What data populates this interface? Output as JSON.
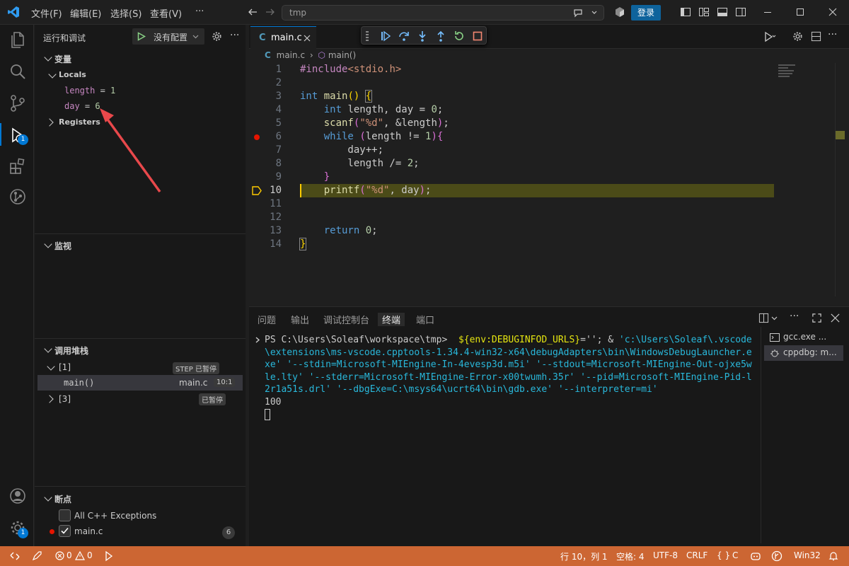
{
  "titlebar": {
    "menus": [
      "文件(F)",
      "编辑(E)",
      "选择(S)",
      "查看(V)",
      "···"
    ],
    "command_center": "tmp",
    "login_label": "登录"
  },
  "activity": {
    "debug_badge": "1",
    "settings_badge": "1"
  },
  "sidebar": {
    "title": "运行和调试",
    "config_label": "没有配置",
    "variables_title": "变量",
    "locals_label": "Locals",
    "locals": [
      {
        "name": "length",
        "value": "1"
      },
      {
        "name": "day",
        "value": "6"
      }
    ],
    "registers_label": "Registers",
    "watch_title": "监视",
    "callstack_title": "调用堆栈",
    "threads": [
      {
        "label": "[1]",
        "status": "STEP 已暂停"
      },
      {
        "label": "[3]",
        "status": "已暂停"
      }
    ],
    "frame": {
      "name": "main()",
      "file": "main.c",
      "pos": "10:1"
    },
    "breakpoints_title": "断点",
    "breakpoints": [
      {
        "label": "All C++ Exceptions",
        "checked": false
      },
      {
        "label": "main.c",
        "checked": true,
        "count": "6"
      }
    ]
  },
  "editor": {
    "tab_label": "main.c",
    "breadcrumb_file": "main.c",
    "breadcrumb_symbol": "main()",
    "current_line": 10,
    "breakpoint_line": 6
  },
  "panel": {
    "tabs": [
      "问题",
      "输出",
      "调试控制台",
      "终端",
      "端口"
    ],
    "active_tab": "终端",
    "terminal_prompt": "PS C:\\Users\\Soleaf\\workspace\\tmp> ",
    "terminal_cmd_yellow": "${env:DEBUGINFOD_URLS}",
    "terminal_cmd_mid": "=''; & ",
    "terminal_cmd_cyan": "'c:\\Users\\Soleaf\\.vscode\\extensions\\ms-vscode.cpptools-1.34.4-win32-x64\\debugAdapters\\bin\\WindowsDebugLauncher.exe' '--stdin=Microsoft-MIEngine-In-4evesp3d.m5i' '--stdout=Microsoft-MIEngine-Out-ojxe5wle.lty' '--stderr=Microsoft-MIEngine-Error-x00twumh.35r' '--pid=Microsoft-MIEngine-Pid-l2r1a51s.drl' '--dbgExe=C:\\msys64\\ucrt64\\bin\\gdb.exe' '--interpreter=mi'",
    "terminal_output": "100",
    "terminals": [
      "gcc.exe ...",
      "cppdbg: m..."
    ]
  },
  "statusbar": {
    "errors": "0",
    "warnings": "0",
    "position": "行 10，列 1",
    "indent": "空格: 4",
    "encoding": "UTF-8",
    "eol": "CRLF",
    "language": "C",
    "platform": "Win32"
  },
  "colors": {
    "status_bg": "#cc6633",
    "accent": "#0078d4",
    "current_line_bg": "#4b4b18"
  }
}
